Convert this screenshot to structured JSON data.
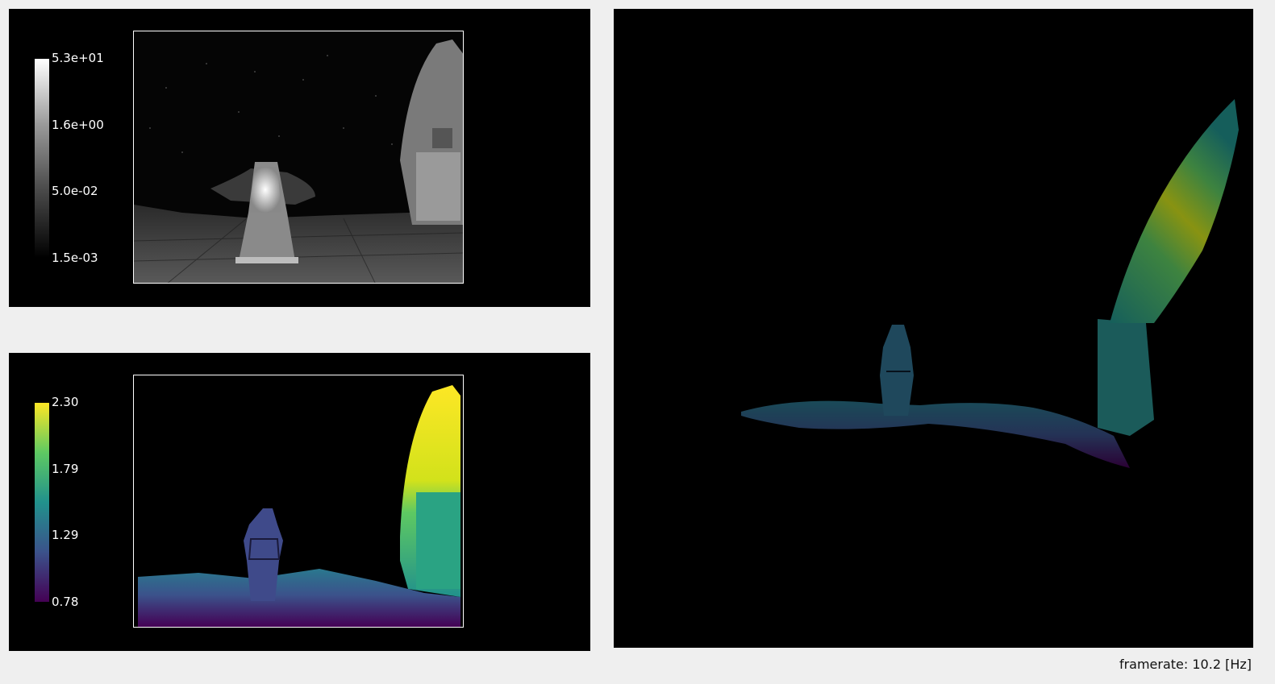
{
  "intensity_panel": {
    "colorbar_ticks": [
      "5.3e+01",
      "1.6e+00",
      "5.0e-02",
      "1.5e-03"
    ],
    "colormap": "gray"
  },
  "depth_panel": {
    "colorbar_ticks": [
      "2.30",
      "1.79",
      "1.29",
      "0.78"
    ],
    "colormap": "viridis"
  },
  "pointcloud_panel": {
    "colormap": "viridis"
  },
  "status": {
    "framerate": "framerate: 10.2 [Hz]"
  }
}
